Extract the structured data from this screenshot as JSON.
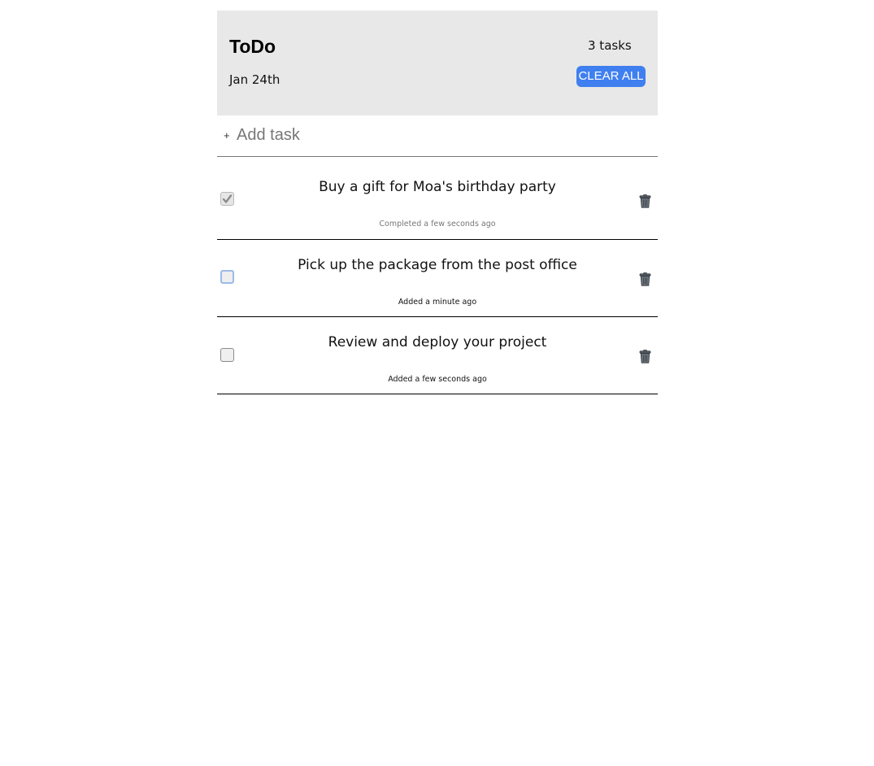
{
  "header": {
    "title": "ToDo",
    "date": "Jan 24th",
    "task_count": "3 tasks",
    "clear_all_label": "CLEAR ALL"
  },
  "add_task": {
    "icon": "plus-icon",
    "icon_glyph": "+",
    "placeholder": "Add task",
    "value": ""
  },
  "tasks": [
    {
      "text": "Buy a gift for Moa's birthday party",
      "meta": "Completed a few seconds ago",
      "completed": true
    },
    {
      "text": "Pick up the package from the post office",
      "meta": "Added a minute ago",
      "completed": false
    },
    {
      "text": "Review and deploy your project",
      "meta": "Added a few seconds ago",
      "completed": false
    }
  ],
  "colors": {
    "accent": "#3f7ff0",
    "header_bg": "#e8e8e8",
    "trash_icon": "#5f6770"
  }
}
